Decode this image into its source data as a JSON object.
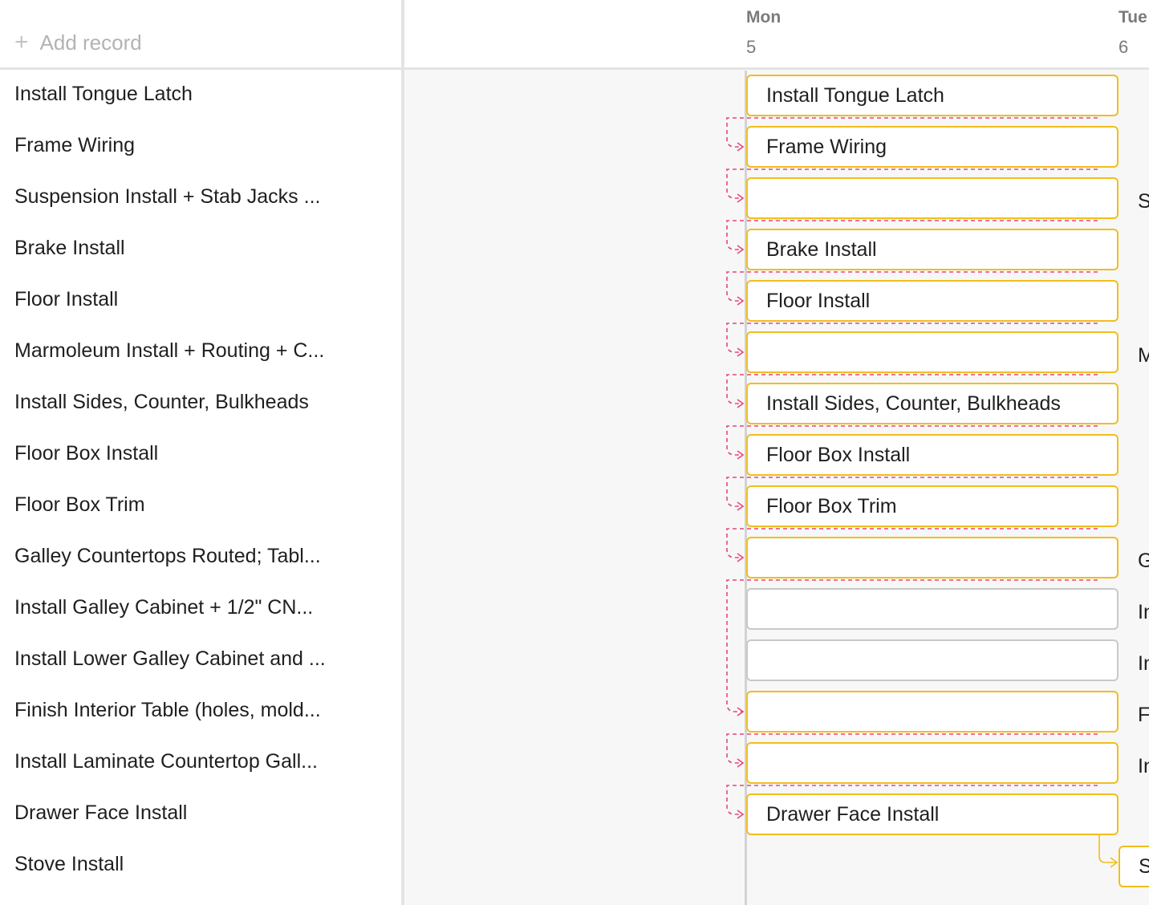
{
  "toolbar": {
    "add_record_label": "Add record"
  },
  "timeline_header": {
    "days": [
      {
        "name": "Mon",
        "number": "5"
      },
      {
        "name": "Tue",
        "number": "6"
      }
    ]
  },
  "records": [
    {
      "label": "Install Tongue Latch",
      "bar_text": "Install Tongue Latch",
      "right_text": "",
      "bar_color": "yellow"
    },
    {
      "label": "Frame Wiring",
      "bar_text": "Frame Wiring",
      "right_text": "",
      "bar_color": "yellow"
    },
    {
      "label": "Suspension Install + Stab Jacks ...",
      "bar_text": "",
      "right_text": "S",
      "bar_color": "yellow"
    },
    {
      "label": "Brake Install",
      "bar_text": "Brake Install",
      "right_text": "",
      "bar_color": "yellow"
    },
    {
      "label": "Floor Install",
      "bar_text": "Floor Install",
      "right_text": "",
      "bar_color": "yellow"
    },
    {
      "label": "Marmoleum Install + Routing + C...",
      "bar_text": "",
      "right_text": "M",
      "bar_color": "yellow"
    },
    {
      "label": "Install Sides, Counter, Bulkheads",
      "bar_text": "Install Sides, Counter, Bulkheads",
      "right_text": "",
      "bar_color": "yellow"
    },
    {
      "label": "Floor Box Install",
      "bar_text": "Floor Box Install",
      "right_text": "",
      "bar_color": "yellow"
    },
    {
      "label": "Floor Box Trim",
      "bar_text": "Floor Box Trim",
      "right_text": "",
      "bar_color": "yellow"
    },
    {
      "label": "Galley Countertops Routed; Tabl...",
      "bar_text": "",
      "right_text": "G",
      "bar_color": "yellow"
    },
    {
      "label": "Install Galley Cabinet + 1/2\" CN...",
      "bar_text": "",
      "right_text": "In",
      "bar_color": "grey"
    },
    {
      "label": "Install Lower Galley Cabinet and ...",
      "bar_text": "",
      "right_text": "In",
      "bar_color": "grey"
    },
    {
      "label": "Finish Interior Table (holes, mold...",
      "bar_text": "",
      "right_text": "F",
      "bar_color": "yellow"
    },
    {
      "label": "Install Laminate Countertop Gall...",
      "bar_text": "",
      "right_text": "In",
      "bar_color": "yellow"
    },
    {
      "label": "Drawer Face Install",
      "bar_text": "Drawer Face Install",
      "right_text": "",
      "bar_color": "yellow"
    },
    {
      "label": "Stove Install",
      "bar_text": "S",
      "right_text": "",
      "bar_color": "yellow"
    }
  ],
  "colors": {
    "bar_border_yellow": "#f2bd1d",
    "bar_border_grey": "#c8c8c8",
    "dependency_dashed": "#e8477a",
    "dependency_solid": "#f2bd1d"
  }
}
